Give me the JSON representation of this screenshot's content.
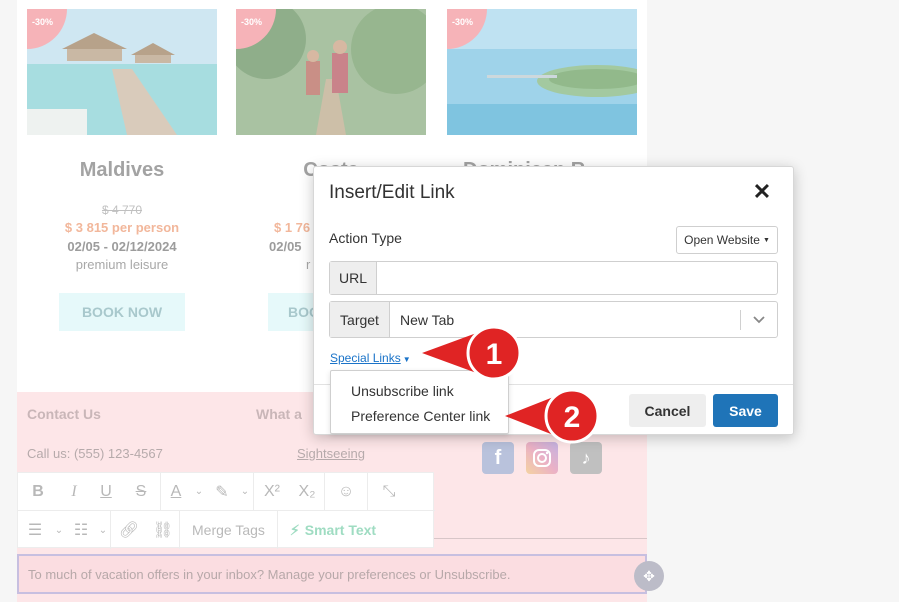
{
  "cards": [
    {
      "badge": "-30%",
      "name": "Maldives",
      "old_price": "$ 4 770",
      "price": "$ 3 815 per person",
      "dates": "02/05 - 02/12/2024",
      "tag": "premium leisure",
      "button": "BOOK NOW",
      "photo": "overwater-bungalows"
    },
    {
      "badge": "-30%",
      "name": "Costa",
      "old_price": "",
      "price": "$ 1 76",
      "dates": "02/05",
      "tag": "r",
      "button": "BOO",
      "photo": "jungle-hikers"
    },
    {
      "badge": "-30%",
      "name": "Dominican R",
      "old_price": "",
      "price": "",
      "dates": "",
      "tag": "",
      "button": "",
      "photo": "tropical-island"
    }
  ],
  "footer": {
    "contact_title": "Contact Us",
    "what_title": "What a",
    "call": "Call us: (555) 123-4567",
    "sightseeing": "Sightseeing",
    "social": {
      "facebook": "f",
      "tiktok": "♪"
    },
    "unsubscribe_text": "To much of vacation offers in your inbox? Manage your preferences or Unsubscribe."
  },
  "toolbar": {
    "row1": [
      "bold-icon",
      "italic-icon",
      "underline-icon",
      "strikethrough-icon",
      "text-color-icon",
      "highlight-icon",
      "superscript-icon",
      "subscript-icon",
      "emoji-icon",
      "clear-format-icon"
    ],
    "row2": [
      "bullet-list-icon",
      "numbered-list-icon",
      "link-icon",
      "unlink-icon"
    ],
    "merge_tags": "Merge Tags",
    "smart_text": "Smart Text"
  },
  "modal": {
    "title": "Insert/Edit Link",
    "close": "✕",
    "action_type_label": "Action Type",
    "action_type_value": "Open Website",
    "url_label": "URL",
    "url_value": "",
    "target_label": "Target",
    "target_value": "New Tab",
    "special_links": "Special Links",
    "cancel": "Cancel",
    "save": "Save"
  },
  "dropdown": {
    "items": [
      "Unsubscribe link",
      "Preference Center link"
    ]
  },
  "callouts": [
    "1",
    "2"
  ],
  "colors": {
    "accent": "#1f74b8",
    "callout": "#e02424",
    "footer_bg": "#fde6e8"
  }
}
